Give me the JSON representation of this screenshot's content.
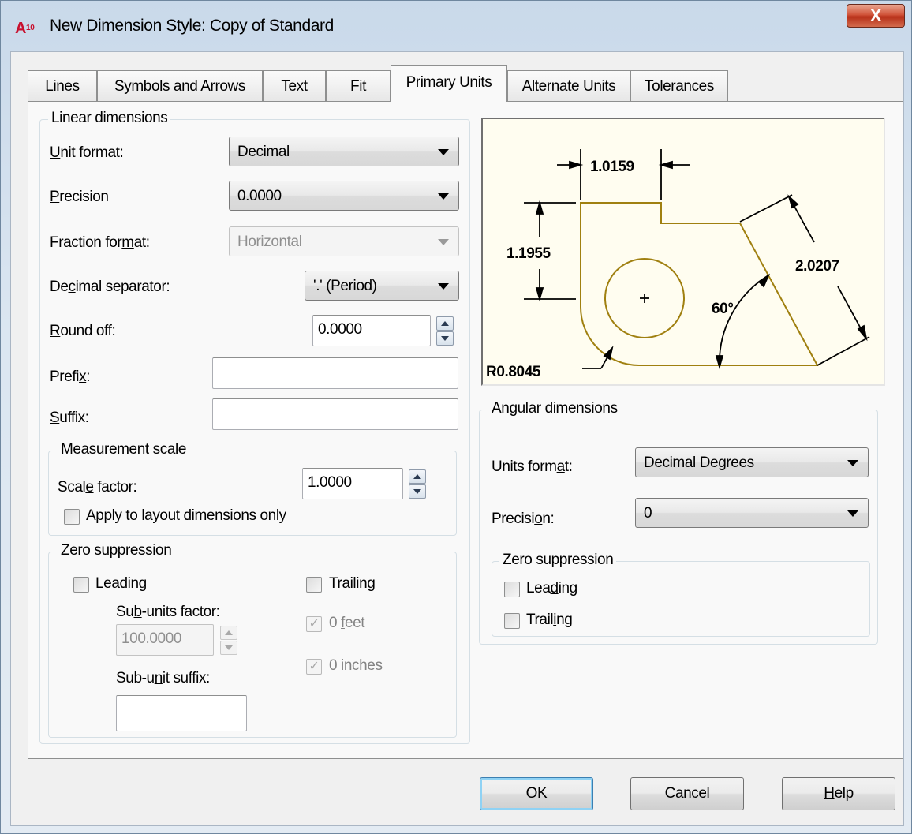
{
  "window": {
    "icon_text": "A",
    "icon_badge": "10",
    "title": "New Dimension Style: Copy of Standard",
    "close_label": "X"
  },
  "tabs": [
    {
      "label": "Lines"
    },
    {
      "label": "Symbols and Arrows"
    },
    {
      "label": "Text"
    },
    {
      "label": "Fit"
    },
    {
      "label": "Primary Units",
      "active": true
    },
    {
      "label": "Alternate Units"
    },
    {
      "label": "Tolerances"
    }
  ],
  "linear": {
    "title": "Linear dimensions",
    "unit_format": {
      "label_u": "U",
      "label_rest": "nit format:",
      "value": "Decimal"
    },
    "precision": {
      "label_u": "P",
      "label_rest": "recision",
      "value": "0.0000"
    },
    "fraction_format": {
      "label_pre": "Fraction for",
      "label_u": "m",
      "label_rest": "at:",
      "value": "Horizontal"
    },
    "decimal_separator": {
      "label_pre": "De",
      "label_u": "c",
      "label_rest": "imal separator:",
      "value": "'.' (Period)"
    },
    "round_off": {
      "label_u": "R",
      "label_rest": "ound off:",
      "value": "0.0000"
    },
    "prefix": {
      "label_pre": "Prefi",
      "label_u": "x",
      "label_rest": ":",
      "value": ""
    },
    "suffix": {
      "label_u": "S",
      "label_rest": "uffix:",
      "value": ""
    }
  },
  "measurement": {
    "title": "Measurement scale",
    "scale_factor": {
      "label_pre": "Scal",
      "label_u": "e",
      "label_rest": " factor:",
      "value": "1.0000"
    },
    "apply_layout": {
      "label": "Apply to layout dimensions only",
      "checked": false
    }
  },
  "zero_linear": {
    "title": "Zero suppression",
    "leading": {
      "label_u": "L",
      "label_rest": "eading"
    },
    "trailing": {
      "label_u": "T",
      "label_rest": "railing"
    },
    "subunits_factor": {
      "label_pre": "Su",
      "label_u": "b",
      "label_rest": "-units factor:",
      "value": "100.0000"
    },
    "subunit_suffix": {
      "label_pre": "Sub-u",
      "label_u": "n",
      "label_rest": "it suffix:",
      "value": ""
    },
    "feet": {
      "label_pre": "0 ",
      "label_u": "f",
      "label_rest": "eet",
      "checked": true
    },
    "inches": {
      "label_pre": "0 ",
      "label_u": "i",
      "label_rest": "nches",
      "checked": true
    }
  },
  "preview": {
    "dim_top": "1.0159",
    "dim_left": "1.1955",
    "dim_right": "2.0207",
    "dim_angle": "60°",
    "dim_radius": "R0.8045",
    "colors": {
      "geometry": "#a08010",
      "dims": "#000000",
      "background": "#fffdf0"
    }
  },
  "angular": {
    "title": "Angular dimensions",
    "units_format": {
      "label_pre": "Units form",
      "label_u": "a",
      "label_rest": "t:",
      "value": "Decimal Degrees"
    },
    "precision": {
      "label_pre": "Precisi",
      "label_u": "o",
      "label_rest": "n:",
      "value": "0"
    },
    "zero_title": "Zero suppression",
    "leading": {
      "label_pre": "Lea",
      "label_u": "d",
      "label_rest": "ing"
    },
    "trailing": {
      "label_pre": "Trail",
      "label_u": "i",
      "label_rest": "ng"
    }
  },
  "buttons": {
    "ok": "OK",
    "cancel": "Cancel",
    "help_u": "H",
    "help_rest": "elp"
  }
}
